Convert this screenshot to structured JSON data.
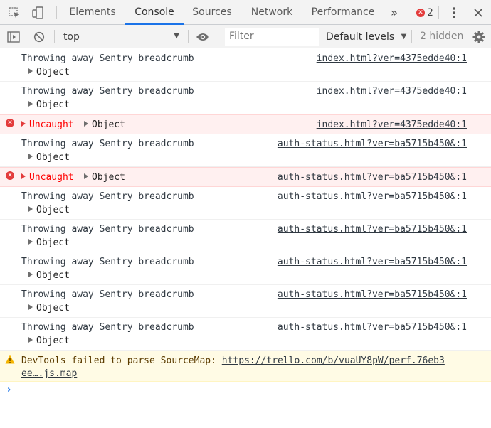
{
  "tabs": [
    {
      "label": "Elements"
    },
    {
      "label": "Console"
    },
    {
      "label": "Sources"
    },
    {
      "label": "Network"
    },
    {
      "label": "Performance"
    }
  ],
  "more_tabs_icon": "double-chevron-right-icon",
  "error_count": "2",
  "toolbar": {
    "context": "top",
    "filter_placeholder": "Filter",
    "levels": "Default levels",
    "hidden": "2 hidden"
  },
  "messages": [
    {
      "type": "log",
      "text": "Throwing away Sentry breadcrumb",
      "object": "Object",
      "source": "index.html?ver=4375edde40:1"
    },
    {
      "type": "log",
      "text": "Throwing away Sentry breadcrumb",
      "object": "Object",
      "source": "index.html?ver=4375edde40:1"
    },
    {
      "type": "error",
      "text": "Uncaught",
      "object": "Object",
      "source": "index.html?ver=4375edde40:1"
    },
    {
      "type": "log",
      "text": "Throwing away Sentry breadcrumb",
      "object": "Object",
      "source": "auth-status.html?ver=ba5715b450&:1"
    },
    {
      "type": "error",
      "text": "Uncaught",
      "object": "Object",
      "source": "auth-status.html?ver=ba5715b450&:1"
    },
    {
      "type": "log",
      "text": "Throwing away Sentry breadcrumb",
      "object": "Object",
      "source": "auth-status.html?ver=ba5715b450&:1"
    },
    {
      "type": "log",
      "text": "Throwing away Sentry breadcrumb",
      "object": "Object",
      "source": "auth-status.html?ver=ba5715b450&:1"
    },
    {
      "type": "log",
      "text": "Throwing away Sentry breadcrumb",
      "object": "Object",
      "source": "auth-status.html?ver=ba5715b450&:1"
    },
    {
      "type": "log",
      "text": "Throwing away Sentry breadcrumb",
      "object": "Object",
      "source": "auth-status.html?ver=ba5715b450&:1"
    },
    {
      "type": "log",
      "text": "Throwing away Sentry breadcrumb",
      "object": "Object",
      "source": "auth-status.html?ver=ba5715b450&:1"
    }
  ],
  "warning": {
    "text": "DevTools failed to parse SourceMap: ",
    "link_line1": "https://trello.com/b/vuaUY8pW/perf.76eb3",
    "link_line2": "ee….js.map"
  },
  "colors": {
    "accent": "#1a73e8",
    "error": "#e33b3b",
    "warning": "#f5b400"
  }
}
